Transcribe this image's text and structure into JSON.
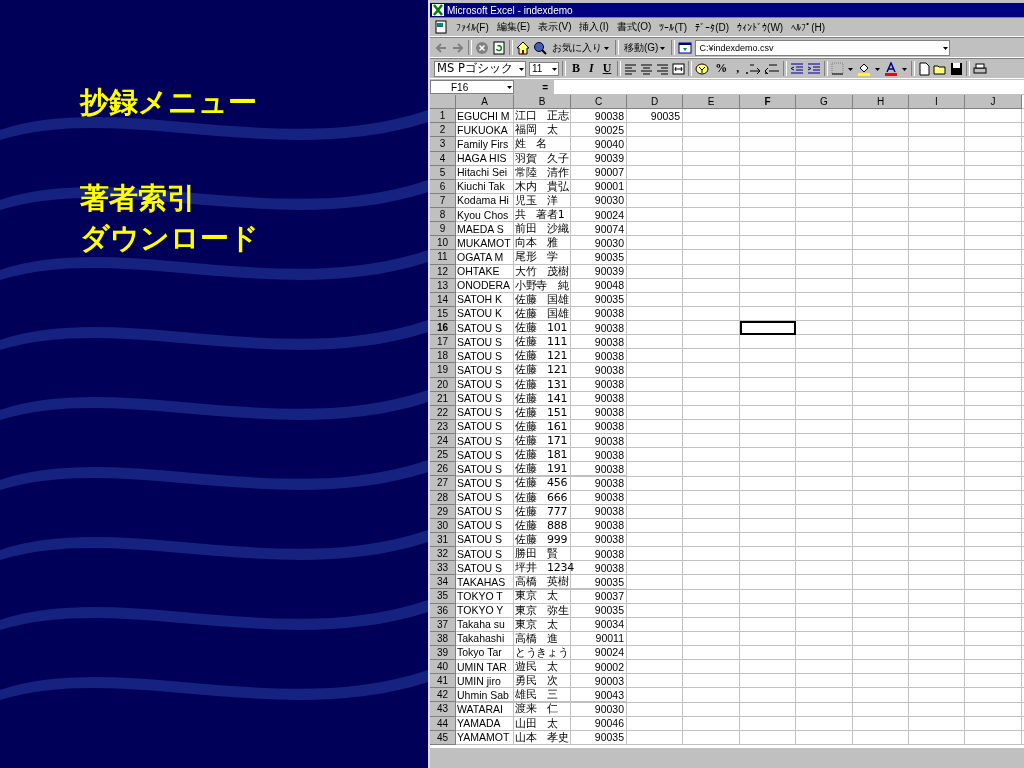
{
  "slide": {
    "items": [
      {
        "text": "抄録メニュー"
      },
      {
        "text": "著者索引"
      },
      {
        "text": "ダウンロード"
      }
    ]
  },
  "window": {
    "title": "Microsoft Excel - indexdemo"
  },
  "menu_bar": [
    "ﾌｧｲﾙ(F)",
    "編集(E)",
    "表示(V)",
    "挿入(I)",
    "書式(O)",
    "ﾂｰﾙ(T)",
    "ﾃﾞｰﾀ(D)",
    "ｳｨﾝﾄﾞｳ(W)",
    "ﾍﾙﾌﾟ(H)"
  ],
  "web_toolbar": {
    "favorites": "お気に入り",
    "go": "移動(G)",
    "address": "C:¥indexdemo.csv"
  },
  "format_toolbar": {
    "font": "MS Pゴシック",
    "size": "11",
    "style_buttons": [
      "B",
      "I",
      "U"
    ],
    "percent": "%",
    "comma": ","
  },
  "formula_bar": {
    "name_box": "F16",
    "equals": "="
  },
  "columns": [
    {
      "label": "A",
      "selected": false
    },
    {
      "label": "B",
      "selected": false
    },
    {
      "label": "C",
      "selected": false
    },
    {
      "label": "D",
      "selected": false
    },
    {
      "label": "E",
      "selected": false
    },
    {
      "label": "F",
      "selected": true
    },
    {
      "label": "G",
      "selected": false
    },
    {
      "label": "H",
      "selected": false
    },
    {
      "label": "I",
      "selected": false
    },
    {
      "label": "J",
      "selected": false
    }
  ],
  "rows": [
    {
      "number": "1",
      "selected": false,
      "cells": [
        "EGUCHI M",
        "江口　正志",
        "90038",
        "90035"
      ]
    },
    {
      "number": "2",
      "selected": false,
      "cells": [
        "FUKUOKA",
        "福岡　太",
        "90025"
      ]
    },
    {
      "number": "3",
      "selected": false,
      "cells": [
        "Family Firs",
        "姓　名",
        "90040"
      ]
    },
    {
      "number": "4",
      "selected": false,
      "cells": [
        "HAGA HIS",
        "羽賀　久子",
        "90039"
      ]
    },
    {
      "number": "5",
      "selected": false,
      "cells": [
        "Hitachi Sei",
        "常陸　清作",
        "90007"
      ]
    },
    {
      "number": "6",
      "selected": false,
      "cells": [
        "Kiuchi Tak",
        "木内　貴弘",
        "90001"
      ]
    },
    {
      "number": "7",
      "selected": false,
      "cells": [
        "Kodama Hi",
        "児玉　洋",
        "90030"
      ]
    },
    {
      "number": "8",
      "selected": false,
      "cells": [
        "Kyou Chos",
        "共　著者1",
        "90024"
      ]
    },
    {
      "number": "9",
      "selected": false,
      "cells": [
        "MAEDA S",
        "前田　沙織",
        "90074"
      ]
    },
    {
      "number": "10",
      "selected": false,
      "cells": [
        "MUKAMOT",
        "向本　雅",
        "90030"
      ]
    },
    {
      "number": "11",
      "selected": false,
      "cells": [
        "OGATA M",
        "尾形　学",
        "90035"
      ]
    },
    {
      "number": "12",
      "selected": false,
      "cells": [
        "OHTAKE",
        "大竹　茂樹",
        "90039"
      ]
    },
    {
      "number": "13",
      "selected": false,
      "cells": [
        "ONODERA",
        "小野寺　純",
        "90048"
      ]
    },
    {
      "number": "14",
      "selected": false,
      "cells": [
        "SATOH K",
        "佐藤　国雄",
        "90035"
      ]
    },
    {
      "number": "15",
      "selected": false,
      "cells": [
        "SATOU K",
        "佐藤　国雄",
        "90038"
      ]
    },
    {
      "number": "16",
      "selected": true,
      "cells": [
        "SATOU S",
        "佐藤　101",
        "90038"
      ]
    },
    {
      "number": "17",
      "selected": false,
      "cells": [
        "SATOU S",
        "佐藤　111",
        "90038"
      ]
    },
    {
      "number": "18",
      "selected": false,
      "cells": [
        "SATOU S",
        "佐藤　121",
        "90038"
      ]
    },
    {
      "number": "19",
      "selected": false,
      "cells": [
        "SATOU S",
        "佐藤　121",
        "90038"
      ]
    },
    {
      "number": "20",
      "selected": false,
      "cells": [
        "SATOU S",
        "佐藤　131",
        "90038"
      ]
    },
    {
      "number": "21",
      "selected": false,
      "cells": [
        "SATOU S",
        "佐藤　141",
        "90038"
      ]
    },
    {
      "number": "22",
      "selected": false,
      "cells": [
        "SATOU S",
        "佐藤　151",
        "90038"
      ]
    },
    {
      "number": "23",
      "selected": false,
      "cells": [
        "SATOU S",
        "佐藤　161",
        "90038"
      ]
    },
    {
      "number": "24",
      "selected": false,
      "cells": [
        "SATOU S",
        "佐藤　171",
        "90038"
      ]
    },
    {
      "number": "25",
      "selected": false,
      "cells": [
        "SATOU S",
        "佐藤　181",
        "90038"
      ]
    },
    {
      "number": "26",
      "selected": false,
      "cells": [
        "SATOU S",
        "佐藤　191",
        "90038"
      ]
    },
    {
      "number": "27",
      "selected": false,
      "cells": [
        "SATOU S",
        "佐藤　456",
        "90038"
      ]
    },
    {
      "number": "28",
      "selected": false,
      "cells": [
        "SATOU S",
        "佐藤　666",
        "90038"
      ]
    },
    {
      "number": "29",
      "selected": false,
      "cells": [
        "SATOU S",
        "佐藤　777",
        "90038"
      ]
    },
    {
      "number": "30",
      "selected": false,
      "cells": [
        "SATOU S",
        "佐藤　888",
        "90038"
      ]
    },
    {
      "number": "31",
      "selected": false,
      "cells": [
        "SATOU S",
        "佐藤　999",
        "90038"
      ]
    },
    {
      "number": "32",
      "selected": false,
      "cells": [
        "SATOU S",
        "勝田　賢",
        "90038"
      ]
    },
    {
      "number": "33",
      "selected": false,
      "cells": [
        "SATOU S",
        "坪井　1234",
        "90038"
      ]
    },
    {
      "number": "34",
      "selected": false,
      "cells": [
        "TAKAHAS",
        "高橋　英樹",
        "90035"
      ]
    },
    {
      "number": "35",
      "selected": false,
      "cells": [
        "TOKYO T",
        "東京　太",
        "90037"
      ]
    },
    {
      "number": "36",
      "selected": false,
      "cells": [
        "TOKYO Y",
        "東京　弥生",
        "90035"
      ]
    },
    {
      "number": "37",
      "selected": false,
      "cells": [
        "Takaha su",
        "東京　太",
        "90034"
      ]
    },
    {
      "number": "38",
      "selected": false,
      "cells": [
        "Takahashi",
        "高橋　進",
        "90011"
      ]
    },
    {
      "number": "39",
      "selected": false,
      "cells": [
        "Tokyo Tar",
        "とうきょう",
        "90024"
      ]
    },
    {
      "number": "40",
      "selected": false,
      "cells": [
        "UMIN TAR",
        "遊民　太",
        "90002"
      ]
    },
    {
      "number": "41",
      "selected": false,
      "cells": [
        "UMIN jiro",
        "勇民　次",
        "90003"
      ]
    },
    {
      "number": "42",
      "selected": false,
      "cells": [
        "Uhmin Sab",
        "雄民　三",
        "90043"
      ]
    },
    {
      "number": "43",
      "selected": false,
      "cells": [
        "WATARAI",
        "渡来　仁",
        "90030"
      ]
    },
    {
      "number": "44",
      "selected": false,
      "cells": [
        "YAMADA",
        "山田　太",
        "90046"
      ]
    },
    {
      "number": "45",
      "selected": false,
      "cells": [
        "YAMAMOT",
        "山本　孝史",
        "90035"
      ]
    }
  ]
}
